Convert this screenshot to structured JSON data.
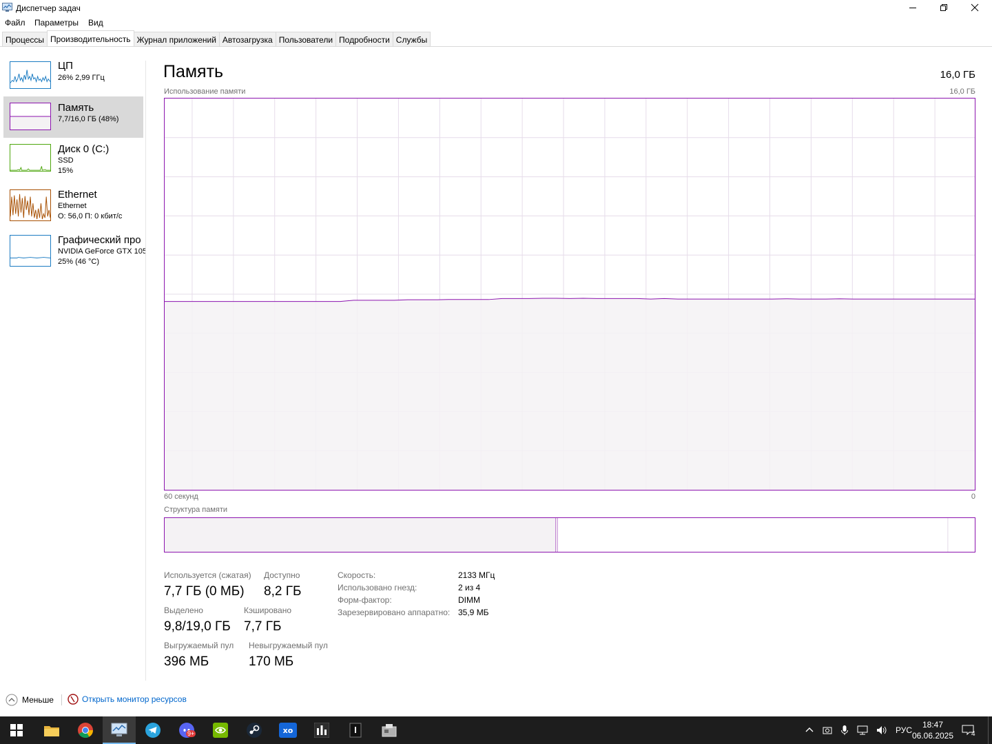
{
  "window": {
    "title": "Диспетчер задач",
    "controls": [
      "minimize-icon",
      "restore-icon",
      "close-icon"
    ]
  },
  "menu": [
    "Файл",
    "Параметры",
    "Вид"
  ],
  "tabs": [
    {
      "label": "Процессы",
      "active": false
    },
    {
      "label": "Производительность",
      "active": true
    },
    {
      "label": "Журнал приложений",
      "active": false
    },
    {
      "label": "Автозагрузка",
      "active": false
    },
    {
      "label": "Пользователи",
      "active": false
    },
    {
      "label": "Подробности",
      "active": false
    },
    {
      "label": "Службы",
      "active": false
    }
  ],
  "sidebar": [
    {
      "name": "ЦП",
      "line1": "26%  2,99 ГГц",
      "line2": "",
      "color": "#1a7bc2",
      "selected": false
    },
    {
      "name": "Память",
      "line1": "7,7/16,0 ГБ (48%)",
      "line2": "",
      "color": "#8b12ae",
      "selected": true
    },
    {
      "name": "Диск 0 (C:)",
      "line1": "SSD",
      "line2": "15%",
      "color": "#4da60c",
      "selected": false
    },
    {
      "name": "Ethernet",
      "line1": "Ethernet",
      "line2": "О: 56,0  П: 0 кбит/с",
      "color": "#a74f01",
      "selected": false
    },
    {
      "name": "Графический про",
      "line1": "NVIDIA GeForce GTX 105",
      "line2": "25%  (46 °C)",
      "color": "#1a7bc2",
      "selected": false
    }
  ],
  "main": {
    "title": "Память",
    "total": "16,0 ГБ",
    "usage_label": "Использование памяти",
    "usage_max": "16,0 ГБ",
    "time_left": "60 секунд",
    "time_right": "0",
    "structure_label": "Структура памяти",
    "accent": "#8b12ae",
    "fill": "#f4f2f4",
    "usage_series": [
      7.7,
      7.7,
      7.7,
      7.7,
      7.7,
      7.7,
      7.7,
      7.7,
      7.7,
      7.7,
      7.7,
      7.7,
      7.7,
      7.7,
      7.75,
      7.75,
      7.75,
      7.75,
      7.77,
      7.77,
      7.77,
      7.78,
      7.78,
      7.78,
      7.78,
      7.82,
      7.82,
      7.82,
      7.83,
      7.83,
      7.82,
      7.83,
      7.82,
      7.82,
      7.82,
      7.82,
      7.8,
      7.82,
      7.8,
      7.8,
      7.8,
      7.8,
      7.8,
      7.8,
      7.8,
      7.8,
      7.81,
      7.8,
      7.8,
      7.8,
      7.81,
      7.8,
      7.8,
      7.8,
      7.8,
      7.8,
      7.8,
      7.8,
      7.8,
      7.8,
      7.8
    ],
    "structure_segments": [
      {
        "kind": "used",
        "fraction": 0.483
      },
      {
        "kind": "modified",
        "fraction": 0.002
      },
      {
        "kind": "standby",
        "fraction": 0.482
      },
      {
        "kind": "free",
        "fraction": 0.033
      }
    ],
    "stats": {
      "in_use_label": "Используется (сжатая)",
      "in_use_value": "7,7 ГБ (0 МБ)",
      "available_label": "Доступно",
      "available_value": "8,2 ГБ",
      "committed_label": "Выделено",
      "committed_value": "9,8/19,0 ГБ",
      "cached_label": "Кэшировано",
      "cached_value": "7,7 ГБ",
      "paged_label": "Выгружаемый пул",
      "paged_value": "396 МБ",
      "nonpaged_label": "Невыгружаемый пул",
      "nonpaged_value": "170 МБ"
    },
    "info": [
      {
        "label": "Скорость:",
        "value": "2133 МГц"
      },
      {
        "label": "Использовано гнезд:",
        "value": "2 из 4"
      },
      {
        "label": "Форм-фактор:",
        "value": "DIMM"
      },
      {
        "label": "Зарезервировано аппаратно:",
        "value": "35,9 МБ"
      }
    ]
  },
  "bottom": {
    "less_label": "Меньше",
    "monitor_link": "Открыть монитор ресурсов"
  },
  "taskbar": {
    "apps": [
      "windows-start-icon",
      "file-explorer-icon",
      "chrome-icon",
      "task-manager-icon",
      "telegram-icon",
      "discord-icon",
      "nvidia-icon",
      "steam-icon",
      "xbox-icon",
      "app-chart-icon",
      "notepad-icon",
      "app-box-icon"
    ],
    "badge": "9+",
    "language": "РУС",
    "time": "18:47",
    "date": "06.06.2025",
    "notifications": "4"
  }
}
